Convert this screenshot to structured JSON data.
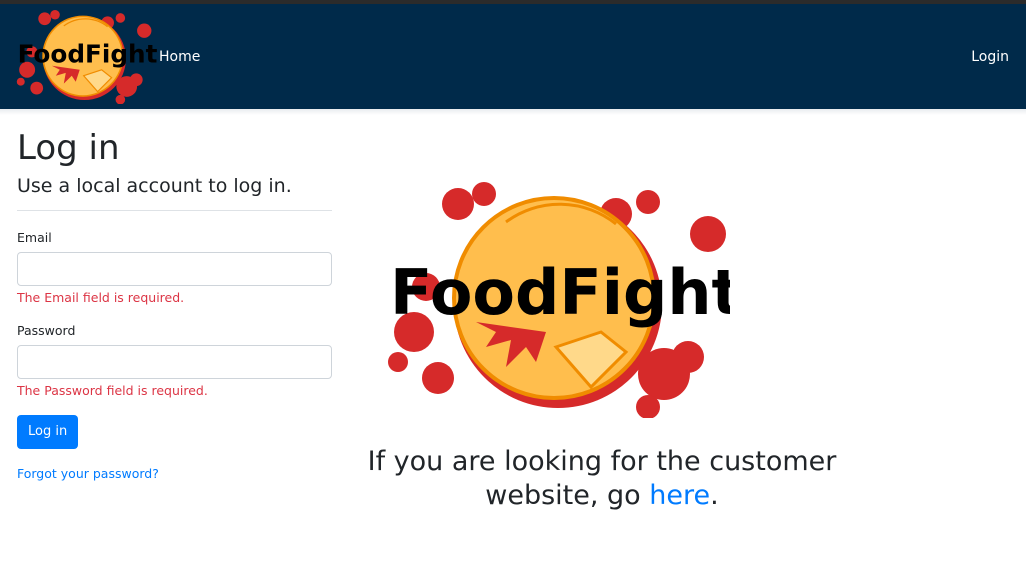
{
  "nav": {
    "brand": "FoodFight",
    "home": "Home",
    "login": "Login"
  },
  "login": {
    "title": "Log in",
    "subtitle": "Use a local account to log in.",
    "email_label": "Email",
    "email_value": "",
    "email_error": "The Email field is required.",
    "password_label": "Password",
    "password_value": "",
    "password_error": "The Password field is required.",
    "submit": "Log in",
    "forgot": "Forgot your password?"
  },
  "hero": {
    "brand": "FoodFight",
    "text_before": "If you are looking for the customer website, go ",
    "link_text": "here",
    "text_after": "."
  },
  "colors": {
    "navbar": "#002a4a",
    "primary": "#007bff",
    "error": "#dc3545",
    "splat": "#d62a2a",
    "pizza": "#ffbe4d",
    "pizza_edge": "#f08c00"
  },
  "icons": {
    "brand_logo": "foodfight-pizza-splat-logo"
  }
}
